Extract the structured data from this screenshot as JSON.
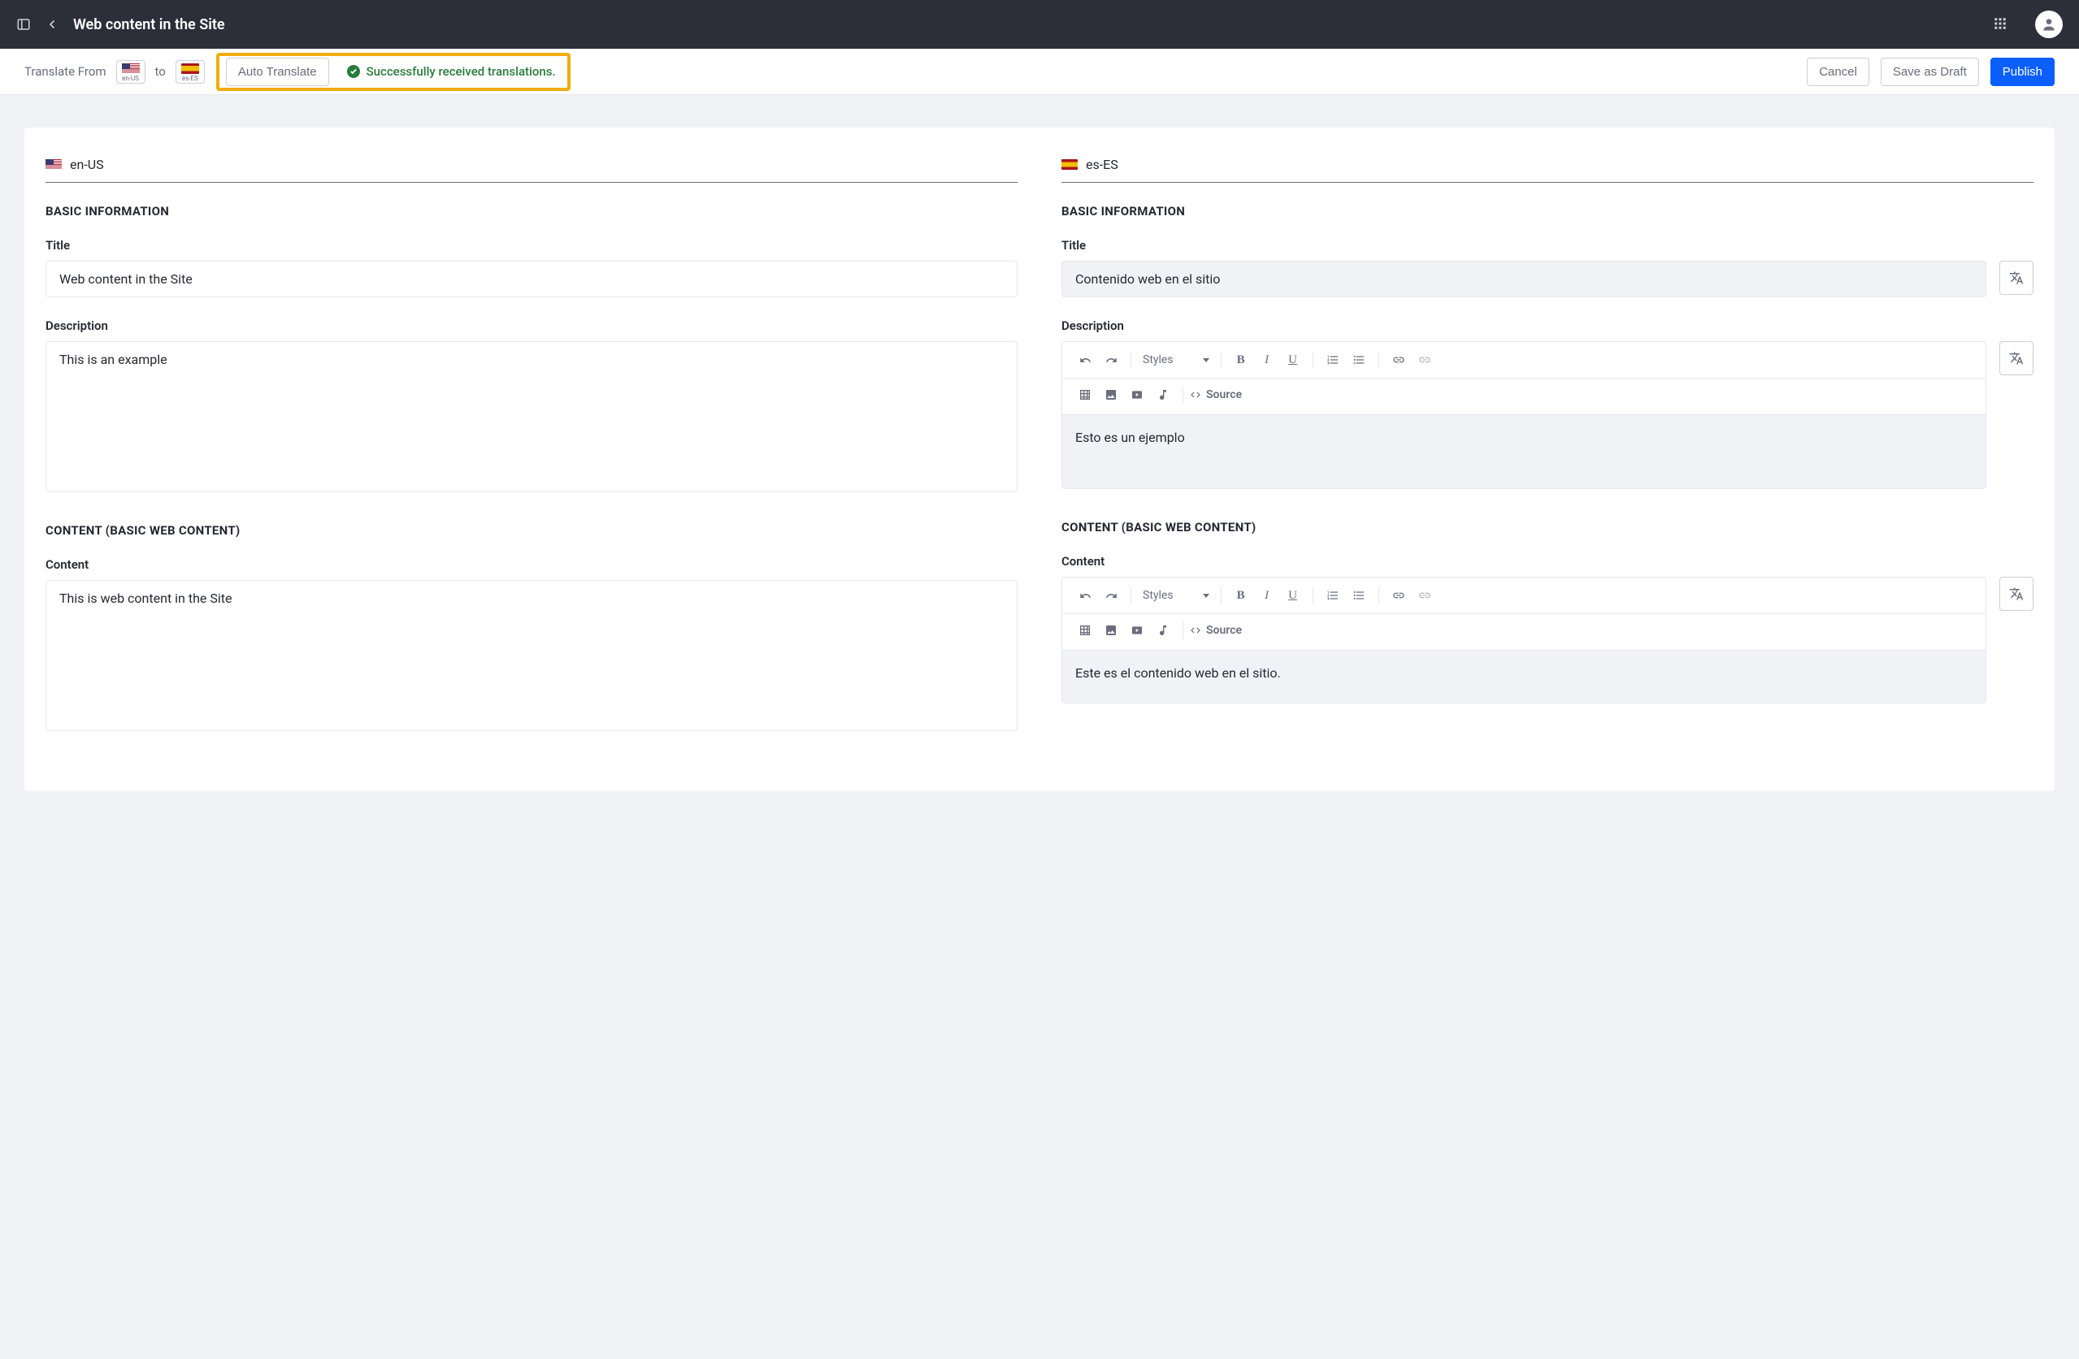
{
  "header": {
    "title": "Web content in the Site"
  },
  "toolbar": {
    "translate_from": "Translate From",
    "to": "to",
    "from_locale": "en-US",
    "to_locale": "es-ES",
    "auto_translate": "Auto Translate",
    "success_message": "Successfully received translations.",
    "cancel": "Cancel",
    "save_draft": "Save as Draft",
    "publish": "Publish"
  },
  "source": {
    "locale": "en-US",
    "basic_info_heading": "BASIC INFORMATION",
    "title_label": "Title",
    "title_value": "Web content in the Site",
    "description_label": "Description",
    "description_value": "This is an example",
    "content_heading": "CONTENT (BASIC WEB CONTENT)",
    "content_label": "Content",
    "content_value": "This is web content in the Site"
  },
  "target": {
    "locale": "es-ES",
    "basic_info_heading": "BASIC INFORMATION",
    "title_label": "Title",
    "title_value": "Contenido web en el sitio",
    "description_label": "Description",
    "description_value": "Esto es un ejemplo",
    "content_heading": "CONTENT (BASIC WEB CONTENT)",
    "content_label": "Content",
    "content_value": "Este es el contenido web en el sitio."
  },
  "editor": {
    "styles": "Styles",
    "source": "Source"
  }
}
